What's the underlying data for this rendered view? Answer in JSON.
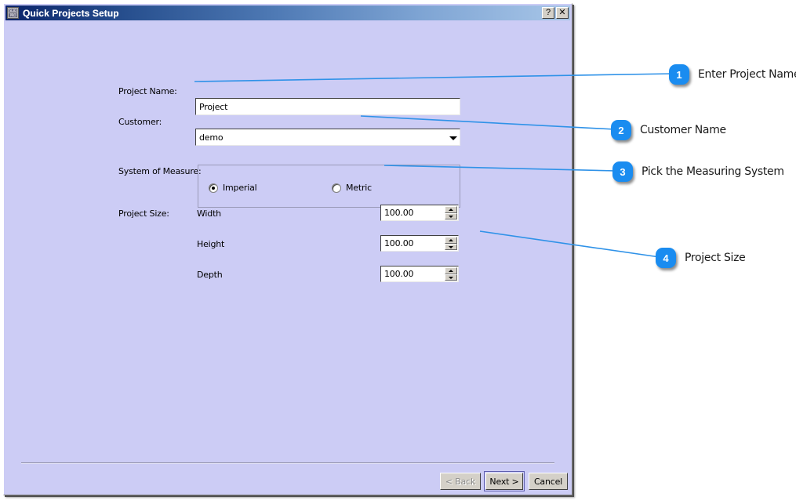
{
  "window": {
    "title": "Quick Projects Setup",
    "icon": "app-icon",
    "icon_line1": "SL3D",
    "icon_line2": "PRO",
    "help_button": "?",
    "close_button": "✕",
    "background_color": "#ccccf5",
    "titlebar_color_start": "#0a246a",
    "titlebar_color_end": "#a8c6e8"
  },
  "form": {
    "project_name": {
      "label": "Project Name:",
      "value": "Project",
      "placeholder": ""
    },
    "customer": {
      "label": "Customer:",
      "value": "demo",
      "arrow_icon": "chevron-down-icon"
    },
    "system_of_measure": {
      "label": "System of Measure:",
      "options": [
        {
          "label": "Imperial",
          "selected": true
        },
        {
          "label": "Metric",
          "selected": false
        }
      ]
    },
    "project_size": {
      "label": "Project Size:",
      "fields": [
        {
          "label": "Width",
          "value": "100.00"
        },
        {
          "label": "Height",
          "value": "100.00"
        },
        {
          "label": "Depth",
          "value": "100.00"
        }
      ]
    }
  },
  "buttons": {
    "back": {
      "label": "< Back",
      "disabled": true
    },
    "next": {
      "label": "Next >",
      "default": true
    },
    "cancel": {
      "label": "Cancel",
      "disabled": false
    }
  },
  "callouts": [
    {
      "number": "1",
      "text": "Enter Project Name"
    },
    {
      "number": "2",
      "text": "Customer Name"
    },
    {
      "number": "3",
      "text": "Pick the Measuring System"
    },
    {
      "number": "4",
      "text": "Project Size"
    }
  ],
  "callout_color": "#1a8cf0"
}
